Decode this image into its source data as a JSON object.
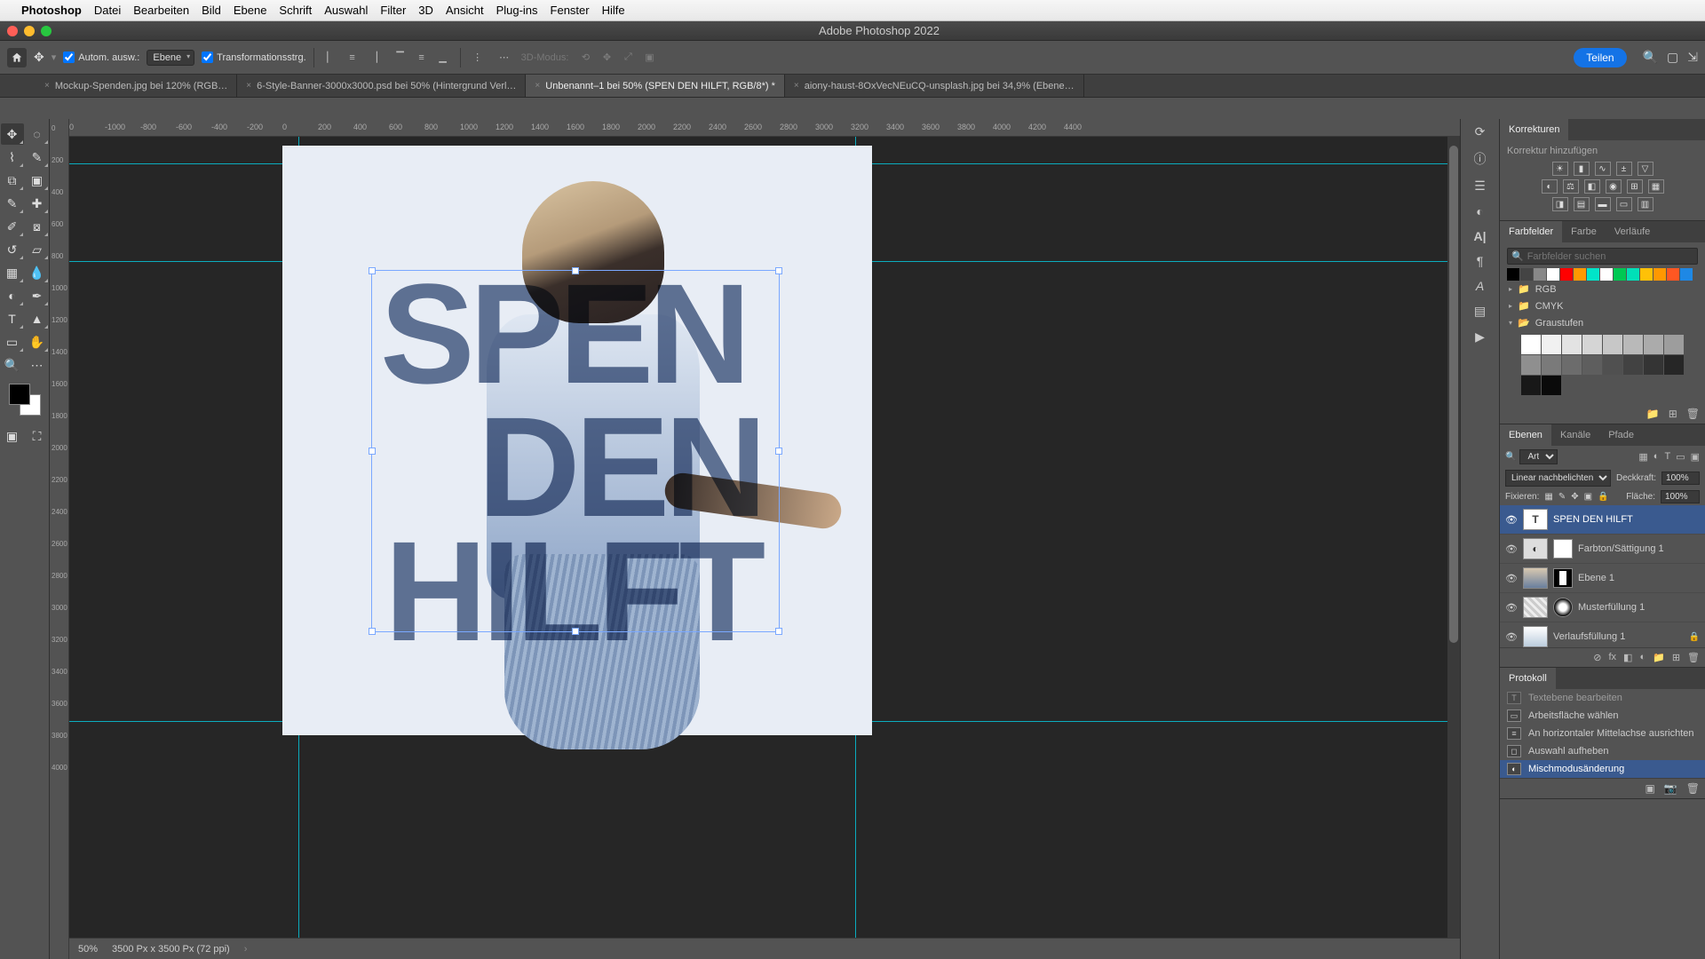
{
  "mac_menu": {
    "app": "Photoshop",
    "items": [
      "Datei",
      "Bearbeiten",
      "Bild",
      "Ebene",
      "Schrift",
      "Auswahl",
      "Filter",
      "3D",
      "Ansicht",
      "Plug-ins",
      "Fenster",
      "Hilfe"
    ]
  },
  "window_title": "Adobe Photoshop 2022",
  "options_bar": {
    "auto_select_label": "Autom. ausw.:",
    "auto_select_target": "Ebene",
    "transform_label": "Transformationsstrg.",
    "mode_3d_label": "3D-Modus:",
    "share_label": "Teilen"
  },
  "doc_tabs": [
    {
      "label": "Mockup-Spenden.jpg bei 120% (RGB…",
      "active": false
    },
    {
      "label": "6-Style-Banner-3000x3000.psd bei 50% (Hintergrund Verl…",
      "active": false
    },
    {
      "label": "Unbenannt–1 bei 50% (SPEN   DEN HILFT, RGB/8*) *",
      "active": true
    },
    {
      "label": "aiony-haust-8OxVecNEuCQ-unsplash.jpg bei 34,9% (Ebene…",
      "active": false
    }
  ],
  "ruler_h": [
    "0",
    "-1000",
    "-800",
    "-600",
    "-400",
    "-200",
    "0",
    "200",
    "400",
    "600",
    "800",
    "1000",
    "1200",
    "1400",
    "1600",
    "1800",
    "2000",
    "2200",
    "2400",
    "2600",
    "2800",
    "3000",
    "3200",
    "3400",
    "3600",
    "3800",
    "4000",
    "4200",
    "4400"
  ],
  "ruler_v": [
    "0",
    "200",
    "400",
    "600",
    "800",
    "1000",
    "1200",
    "1400",
    "1600",
    "1800",
    "2000",
    "2200",
    "2400",
    "2600",
    "2800",
    "3000",
    "3200",
    "3400",
    "3600",
    "3800",
    "4000"
  ],
  "canvas_text": {
    "line1": "SPEN",
    "line2": "DEN",
    "line3": "HILFT"
  },
  "status": {
    "zoom": "50%",
    "docinfo": "3500 Px x 3500 Px (72 ppi)"
  },
  "panels": {
    "adjustments": {
      "tab": "Korrekturen",
      "add_label": "Korrektur hinzufügen"
    },
    "swatches": {
      "tabs": [
        "Farbfelder",
        "Farbe",
        "Verläufe"
      ],
      "search_placeholder": "Farbfelder suchen",
      "row1": [
        "#000000",
        "#444444",
        "#888888",
        "#ffffff",
        "#ff0000",
        "#ff9900",
        "#00e5c9",
        "#ffffff",
        "#00c853",
        "#00e0b8",
        "#ffc107",
        "#ff9800",
        "#ff5722",
        "#1e88e5"
      ],
      "folders": [
        {
          "name": "RGB",
          "open": false
        },
        {
          "name": "CMYK",
          "open": false
        },
        {
          "name": "Graustufen",
          "open": true
        }
      ],
      "grays": [
        "#ffffff",
        "#f1f1f1",
        "#e3e3e3",
        "#d5d5d5",
        "#c7c7c7",
        "#b9b9b9",
        "#ababab",
        "#9d9d9d",
        "#8f8f8f",
        "#7a7a7a",
        "#6c6c6c",
        "#5e5e5e",
        "#505050",
        "#424242",
        "#343434",
        "#262626",
        "#181818",
        "#0a0a0a"
      ]
    },
    "layers": {
      "tabs": [
        "Ebenen",
        "Kanäle",
        "Pfade"
      ],
      "filter_kind": "Art",
      "blend_mode": "Linear nachbelichten",
      "opacity_label": "Deckkraft:",
      "opacity_value": "100%",
      "lock_label": "Fixieren:",
      "fill_label": "Fläche:",
      "fill_value": "100%",
      "items": [
        {
          "name": "SPEN   DEN HILFT",
          "type": "text",
          "selected": true,
          "locked": false
        },
        {
          "name": "Farbton/Sättigung 1",
          "type": "adj",
          "selected": false,
          "locked": false
        },
        {
          "name": "Ebene 1",
          "type": "image",
          "selected": false,
          "locked": false
        },
        {
          "name": "Musterfüllung 1",
          "type": "pattern",
          "selected": false,
          "locked": false
        },
        {
          "name": "Verlaufsfüllung 1",
          "type": "gradient",
          "selected": false,
          "locked": true
        }
      ]
    },
    "history": {
      "tab": "Protokoll",
      "items": [
        {
          "label": "Textebene bearbeiten",
          "selected": false
        },
        {
          "label": "Arbeitsfläche wählen",
          "selected": false
        },
        {
          "label": "An horizontaler Mittelachse ausrichten",
          "selected": false
        },
        {
          "label": "Auswahl aufheben",
          "selected": false
        },
        {
          "label": "Mischmodusänderung",
          "selected": true
        }
      ]
    }
  }
}
